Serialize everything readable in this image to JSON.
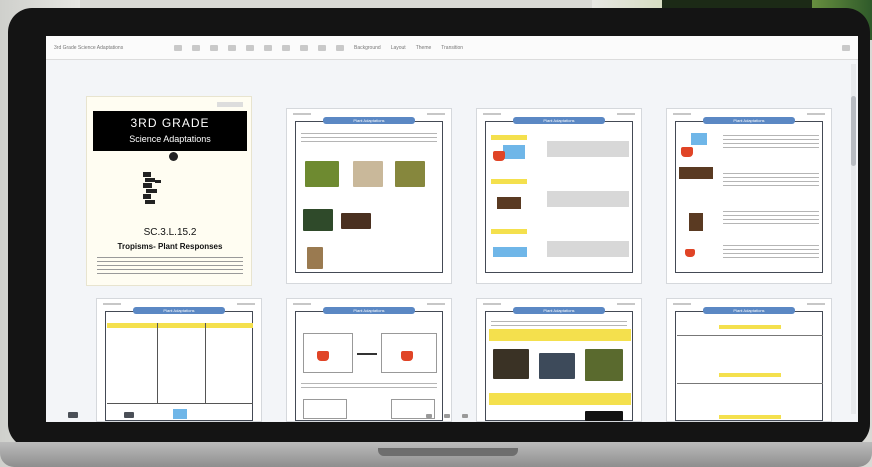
{
  "window": {
    "filename": "3rd Grade Science Adaptations",
    "toolbar_labels": [
      "Background",
      "Layout",
      "Theme",
      "Transition"
    ]
  },
  "cover": {
    "grade": "3RD GRADE",
    "subtitle": "Science Adaptations",
    "standard": "SC.3.L.15.2",
    "topic": "Tropisms- Plant Responses"
  },
  "pages": [
    {
      "id": "page-2",
      "title": "Plant Adaptations"
    },
    {
      "id": "page-3",
      "title": "Plant Adaptations"
    },
    {
      "id": "page-4",
      "title": "Plant Adaptations"
    },
    {
      "id": "page-5",
      "title": "Plant Adaptations"
    },
    {
      "id": "page-6",
      "title": "Plant Adaptations"
    },
    {
      "id": "page-7",
      "title": "Plant Adaptations"
    },
    {
      "id": "page-8",
      "title": "Plant Adaptations"
    }
  ],
  "colors": {
    "title_bar": "#5b88c4",
    "highlight": "#f4e04d",
    "bezel": "#141414"
  }
}
